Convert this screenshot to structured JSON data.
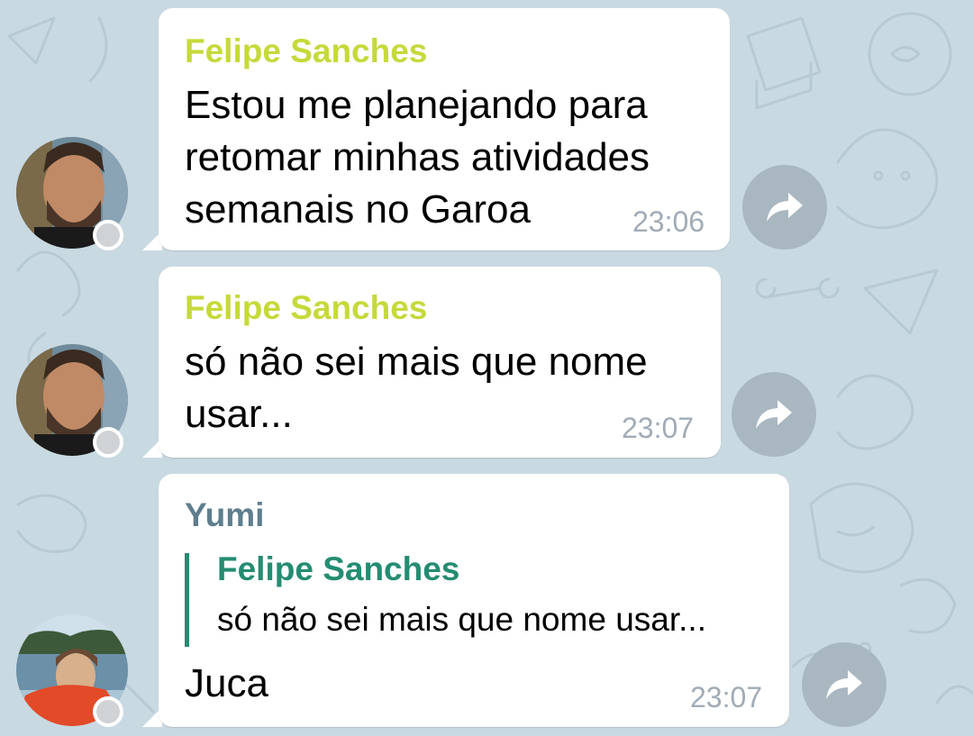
{
  "colors": {
    "felipe_name": "#c6d93a",
    "yumi_name": "#5e7e8e",
    "quote_name": "#248c72",
    "timestamp": "#a0acb6",
    "forward_button": "#a9b7c1",
    "wallpaper": "#c8d8e0"
  },
  "messages": [
    {
      "sender": "Felipe Sanches",
      "lines": [
        "Estou me planejando para",
        "retomar minhas atividades",
        "semanais no Garoa"
      ],
      "time": "23:06",
      "avatar": "felipe-avatar"
    },
    {
      "sender": "Felipe Sanches",
      "lines": [
        "só não sei mais que nome",
        "usar..."
      ],
      "time": "23:07",
      "avatar": "felipe-avatar"
    },
    {
      "sender": "Yumi",
      "reply": {
        "sender": "Felipe Sanches",
        "text": "só não sei mais que nome usar..."
      },
      "lines": [
        "Juca"
      ],
      "time": "23:07",
      "avatar": "yumi-avatar"
    }
  ],
  "icons": {
    "forward": "forward-arrow-icon"
  }
}
